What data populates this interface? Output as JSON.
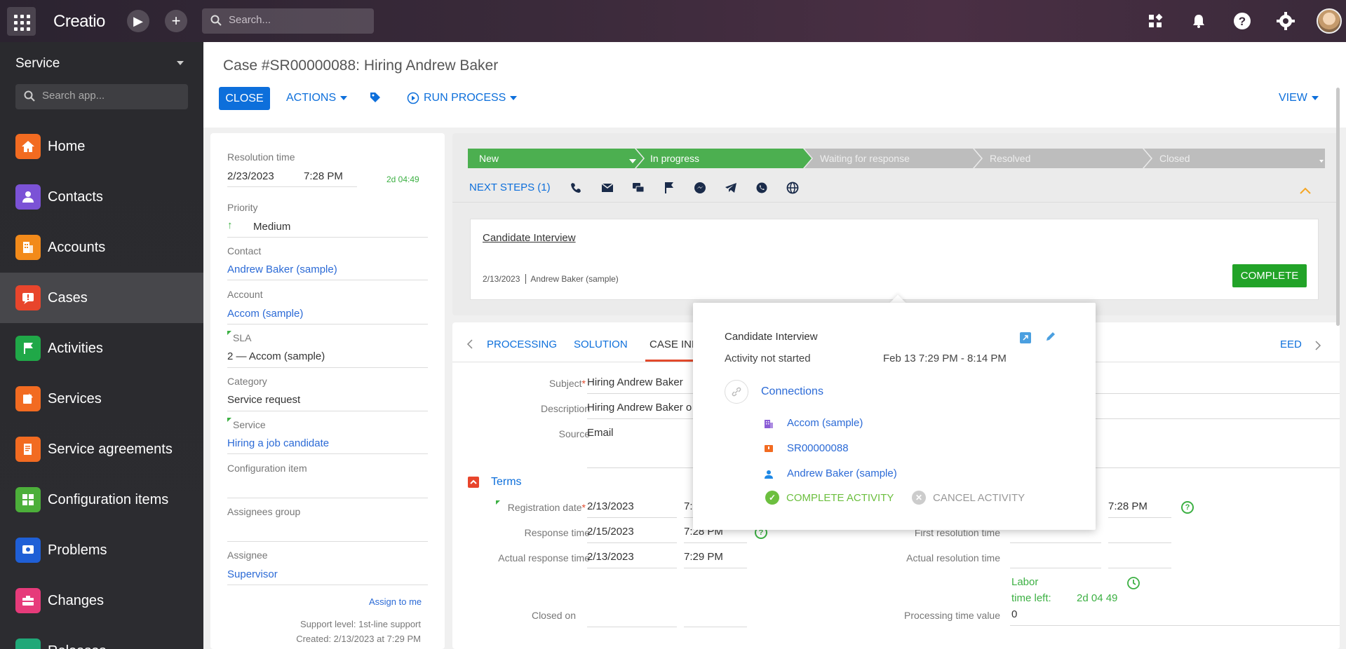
{
  "topbar": {
    "logo": "Creatio",
    "search_placeholder": "Search..."
  },
  "sidebar": {
    "workspace": "Service",
    "search_placeholder": "Search app...",
    "items": [
      {
        "label": "Home",
        "icon": "home-icon",
        "color": "#f26b21"
      },
      {
        "label": "Contacts",
        "icon": "contact-icon",
        "color": "#7b52d6"
      },
      {
        "label": "Accounts",
        "icon": "building-icon",
        "color": "#f28a1a"
      },
      {
        "label": "Cases",
        "icon": "case-icon",
        "color": "#e8452c"
      },
      {
        "label": "Activities",
        "icon": "flag-icon",
        "color": "#20a848"
      },
      {
        "label": "Services",
        "icon": "services-icon",
        "color": "#f26b21"
      },
      {
        "label": "Service agreements",
        "icon": "agreement-icon",
        "color": "#f26b21"
      },
      {
        "label": "Configuration items",
        "icon": "config-icon",
        "color": "#4caf3a"
      },
      {
        "label": "Problems",
        "icon": "problem-icon",
        "color": "#1f5fd6"
      },
      {
        "label": "Changes",
        "icon": "changes-icon",
        "color": "#e63b7a"
      },
      {
        "label": "Releases",
        "icon": "release-icon",
        "color": "#20a878"
      }
    ]
  },
  "header": {
    "title": "Case #SR00000088: Hiring Andrew Baker",
    "close": "CLOSE",
    "actions": "ACTIONS",
    "run_process": "RUN PROCESS",
    "view": "VIEW"
  },
  "left": {
    "resolution_label": "Resolution time",
    "resolution_date": "2/23/2023",
    "resolution_time": "7:28 PM",
    "resolution_left": "2d 04:49",
    "priority_label": "Priority",
    "priority_value": "Medium",
    "contact_label": "Contact",
    "contact_value": "Andrew Baker (sample)",
    "account_label": "Account",
    "account_value": "Accom (sample)",
    "sla_label": "SLA",
    "sla_value": "2 — Accom (sample)",
    "category_label": "Category",
    "category_value": "Service request",
    "service_label": "Service",
    "service_value": "Hiring a job candidate",
    "config_label": "Configuration item",
    "assignees_group_label": "Assignees group",
    "assignee_label": "Assignee",
    "assignee_value": "Supervisor",
    "assign_to_me": "Assign to me",
    "support_level": "Support level: 1st-line support",
    "created": "Created: 2/13/2023 at 7:29 PM"
  },
  "stages": [
    "New",
    "In progress",
    "Waiting for response",
    "Resolved",
    "Closed"
  ],
  "next_steps": "NEXT STEPS (1)",
  "activity": {
    "title": "Candidate Interview",
    "date": "2/13/2023",
    "owner": "Andrew Baker (sample)",
    "complete": "COMPLETE"
  },
  "tabs": [
    "PROCESSING",
    "SOLUTION",
    "CASE INF",
    "EED"
  ],
  "form": {
    "subject_label": "Subject",
    "subject_value": "Hiring Andrew Baker",
    "description_label": "Description",
    "description_value": "Hiring Andrew Baker o",
    "source_label": "Source",
    "source_value": "Email",
    "terms": "Terms",
    "reg_label": "Registration date",
    "reg_date": "2/13/2023",
    "reg_time": "7:",
    "resp_label": "Response time",
    "resp_date": "2/15/2023",
    "resp_time": "7:28 PM",
    "actual_resp_label": "Actual response time",
    "actual_resp_date": "2/13/2023",
    "actual_resp_time": "7:29 PM",
    "closed_label": "Closed on",
    "right_time": "7:28 PM",
    "first_res_label": "First resolution time",
    "actual_res_label": "Actual resolution time",
    "labor_label": "Labor",
    "time_left_label": "time left:",
    "time_left_value": "2d 04 49",
    "processing_label": "Processing time value",
    "processing_value": "0"
  },
  "popup": {
    "title": "Candidate Interview",
    "status": "Activity not started",
    "time": "Feb 13 7:29 PM - 8:14 PM",
    "connections": "Connections",
    "links": [
      "Accom (sample)",
      "SR00000088",
      "Andrew Baker (sample)"
    ],
    "complete": "COMPLETE ACTIVITY",
    "cancel": "CANCEL ACTIVITY"
  }
}
